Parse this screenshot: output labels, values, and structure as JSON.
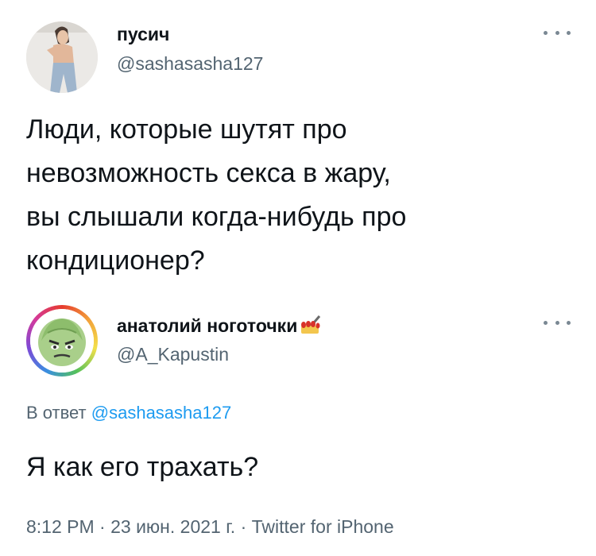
{
  "main_tweet": {
    "author_name": "пусич",
    "author_handle": "@sashasasha127",
    "text": "Люди, которые шутят про\nневозможность секса в жару,\nвы слышали когда-нибудь про\nкондиционер?",
    "avatar_icon": "person-photo-avatar"
  },
  "reply_tweet": {
    "author_name": "анатолий ноготочки",
    "name_emoji_icon": "nail-polish-icon",
    "author_handle": "@A_Kapustin",
    "avatar_icon": "cabbage-face-avatar",
    "reply_prefix": "В ответ",
    "reply_handle": "@sashasasha127",
    "text": "Я как его трахать?",
    "time": "8:12 PM",
    "date": "23 июн. 2021 г.",
    "source": "Twitter for iPhone"
  },
  "colors": {
    "text": "#0f1419",
    "secondary": "#536471",
    "link": "#1d9bf0"
  }
}
